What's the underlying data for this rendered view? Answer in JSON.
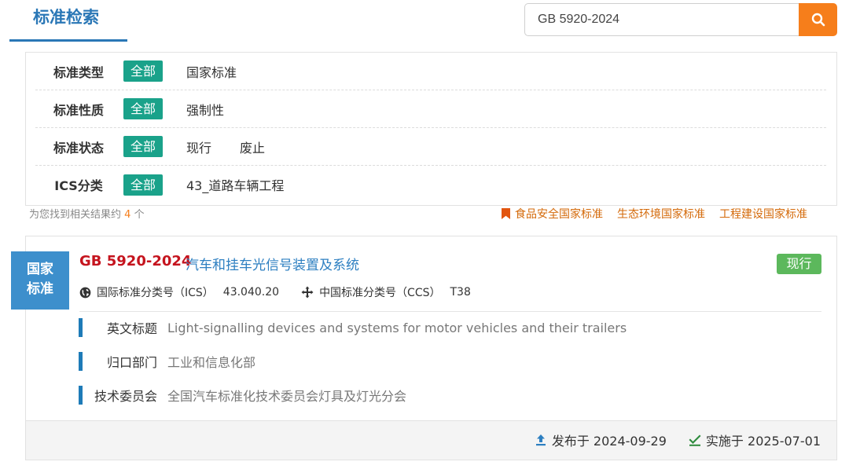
{
  "header": {
    "title": "标准检索",
    "search": {
      "value": "GB 5920-2024"
    }
  },
  "filters": [
    {
      "label": "标准类型",
      "all": "全部",
      "options": [
        "国家标准"
      ]
    },
    {
      "label": "标准性质",
      "all": "全部",
      "options": [
        "强制性"
      ]
    },
    {
      "label": "标准状态",
      "all": "全部",
      "options": [
        "现行",
        "废止"
      ]
    },
    {
      "label": "ICS分类",
      "all": "全部",
      "options": [
        "43_道路车辆工程"
      ]
    }
  ],
  "results": {
    "prefix": "为您找到相关结果约",
    "count": "4",
    "suffix": "个",
    "quick_links": [
      "食品安全国家标准",
      "生态环境国家标准",
      "工程建设国家标准"
    ]
  },
  "card": {
    "type_line1": "国家",
    "type_line2": "标准",
    "code": "GB 5920-2024",
    "title": "汽车和挂车光信号装置及系统",
    "status": "现行",
    "ics_label": "国际标准分类号（ICS）",
    "ics_value": "43.040.20",
    "ccs_label": "中国标准分类号（CCS）",
    "ccs_value": "T38",
    "info": [
      {
        "key": "英文标题",
        "value": "Light-signalling devices and systems for motor vehicles and their trailers"
      },
      {
        "key": "归口部门",
        "value": "工业和信息化部"
      },
      {
        "key": "技术委员会",
        "value": "全国汽车标准化技术委员会灯具及灯光分会"
      }
    ],
    "published": "发布于 2024-09-29",
    "implemented": "实施于 2025-07-01"
  },
  "colors": {
    "primary": "#2a77b6",
    "search_button": "#f67e1b",
    "filter_all": "#1aa28a",
    "code_red": "#c5141e",
    "status_green": "#5cb85c",
    "quick_link": "#d46a0a"
  },
  "icons": [
    "search-icon",
    "bookmark-icon",
    "globe-icon",
    "move-icon",
    "upload-icon",
    "check-icon"
  ]
}
